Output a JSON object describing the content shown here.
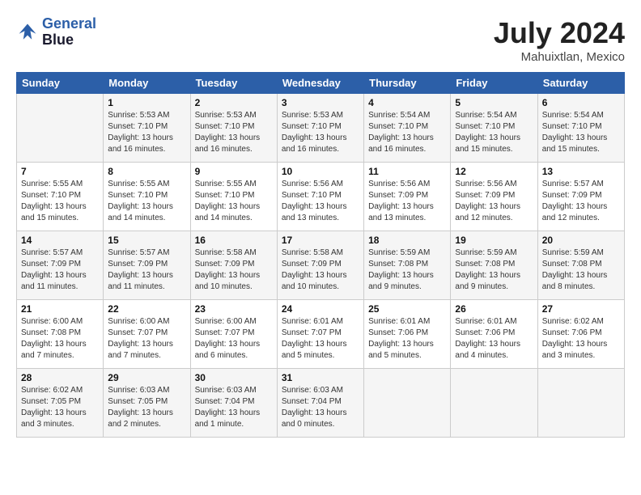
{
  "header": {
    "logo_line1": "General",
    "logo_line2": "Blue",
    "month_year": "July 2024",
    "location": "Mahuixtlan, Mexico"
  },
  "weekdays": [
    "Sunday",
    "Monday",
    "Tuesday",
    "Wednesday",
    "Thursday",
    "Friday",
    "Saturday"
  ],
  "weeks": [
    [
      {
        "day": "",
        "info": ""
      },
      {
        "day": "1",
        "info": "Sunrise: 5:53 AM\nSunset: 7:10 PM\nDaylight: 13 hours\nand 16 minutes."
      },
      {
        "day": "2",
        "info": "Sunrise: 5:53 AM\nSunset: 7:10 PM\nDaylight: 13 hours\nand 16 minutes."
      },
      {
        "day": "3",
        "info": "Sunrise: 5:53 AM\nSunset: 7:10 PM\nDaylight: 13 hours\nand 16 minutes."
      },
      {
        "day": "4",
        "info": "Sunrise: 5:54 AM\nSunset: 7:10 PM\nDaylight: 13 hours\nand 16 minutes."
      },
      {
        "day": "5",
        "info": "Sunrise: 5:54 AM\nSunset: 7:10 PM\nDaylight: 13 hours\nand 15 minutes."
      },
      {
        "day": "6",
        "info": "Sunrise: 5:54 AM\nSunset: 7:10 PM\nDaylight: 13 hours\nand 15 minutes."
      }
    ],
    [
      {
        "day": "7",
        "info": "Sunrise: 5:55 AM\nSunset: 7:10 PM\nDaylight: 13 hours\nand 15 minutes."
      },
      {
        "day": "8",
        "info": "Sunrise: 5:55 AM\nSunset: 7:10 PM\nDaylight: 13 hours\nand 14 minutes."
      },
      {
        "day": "9",
        "info": "Sunrise: 5:55 AM\nSunset: 7:10 PM\nDaylight: 13 hours\nand 14 minutes."
      },
      {
        "day": "10",
        "info": "Sunrise: 5:56 AM\nSunset: 7:10 PM\nDaylight: 13 hours\nand 13 minutes."
      },
      {
        "day": "11",
        "info": "Sunrise: 5:56 AM\nSunset: 7:09 PM\nDaylight: 13 hours\nand 13 minutes."
      },
      {
        "day": "12",
        "info": "Sunrise: 5:56 AM\nSunset: 7:09 PM\nDaylight: 13 hours\nand 12 minutes."
      },
      {
        "day": "13",
        "info": "Sunrise: 5:57 AM\nSunset: 7:09 PM\nDaylight: 13 hours\nand 12 minutes."
      }
    ],
    [
      {
        "day": "14",
        "info": "Sunrise: 5:57 AM\nSunset: 7:09 PM\nDaylight: 13 hours\nand 11 minutes."
      },
      {
        "day": "15",
        "info": "Sunrise: 5:57 AM\nSunset: 7:09 PM\nDaylight: 13 hours\nand 11 minutes."
      },
      {
        "day": "16",
        "info": "Sunrise: 5:58 AM\nSunset: 7:09 PM\nDaylight: 13 hours\nand 10 minutes."
      },
      {
        "day": "17",
        "info": "Sunrise: 5:58 AM\nSunset: 7:09 PM\nDaylight: 13 hours\nand 10 minutes."
      },
      {
        "day": "18",
        "info": "Sunrise: 5:59 AM\nSunset: 7:08 PM\nDaylight: 13 hours\nand 9 minutes."
      },
      {
        "day": "19",
        "info": "Sunrise: 5:59 AM\nSunset: 7:08 PM\nDaylight: 13 hours\nand 9 minutes."
      },
      {
        "day": "20",
        "info": "Sunrise: 5:59 AM\nSunset: 7:08 PM\nDaylight: 13 hours\nand 8 minutes."
      }
    ],
    [
      {
        "day": "21",
        "info": "Sunrise: 6:00 AM\nSunset: 7:08 PM\nDaylight: 13 hours\nand 7 minutes."
      },
      {
        "day": "22",
        "info": "Sunrise: 6:00 AM\nSunset: 7:07 PM\nDaylight: 13 hours\nand 7 minutes."
      },
      {
        "day": "23",
        "info": "Sunrise: 6:00 AM\nSunset: 7:07 PM\nDaylight: 13 hours\nand 6 minutes."
      },
      {
        "day": "24",
        "info": "Sunrise: 6:01 AM\nSunset: 7:07 PM\nDaylight: 13 hours\nand 5 minutes."
      },
      {
        "day": "25",
        "info": "Sunrise: 6:01 AM\nSunset: 7:06 PM\nDaylight: 13 hours\nand 5 minutes."
      },
      {
        "day": "26",
        "info": "Sunrise: 6:01 AM\nSunset: 7:06 PM\nDaylight: 13 hours\nand 4 minutes."
      },
      {
        "day": "27",
        "info": "Sunrise: 6:02 AM\nSunset: 7:06 PM\nDaylight: 13 hours\nand 3 minutes."
      }
    ],
    [
      {
        "day": "28",
        "info": "Sunrise: 6:02 AM\nSunset: 7:05 PM\nDaylight: 13 hours\nand 3 minutes."
      },
      {
        "day": "29",
        "info": "Sunrise: 6:03 AM\nSunset: 7:05 PM\nDaylight: 13 hours\nand 2 minutes."
      },
      {
        "day": "30",
        "info": "Sunrise: 6:03 AM\nSunset: 7:04 PM\nDaylight: 13 hours\nand 1 minute."
      },
      {
        "day": "31",
        "info": "Sunrise: 6:03 AM\nSunset: 7:04 PM\nDaylight: 13 hours\nand 0 minutes."
      },
      {
        "day": "",
        "info": ""
      },
      {
        "day": "",
        "info": ""
      },
      {
        "day": "",
        "info": ""
      }
    ]
  ]
}
